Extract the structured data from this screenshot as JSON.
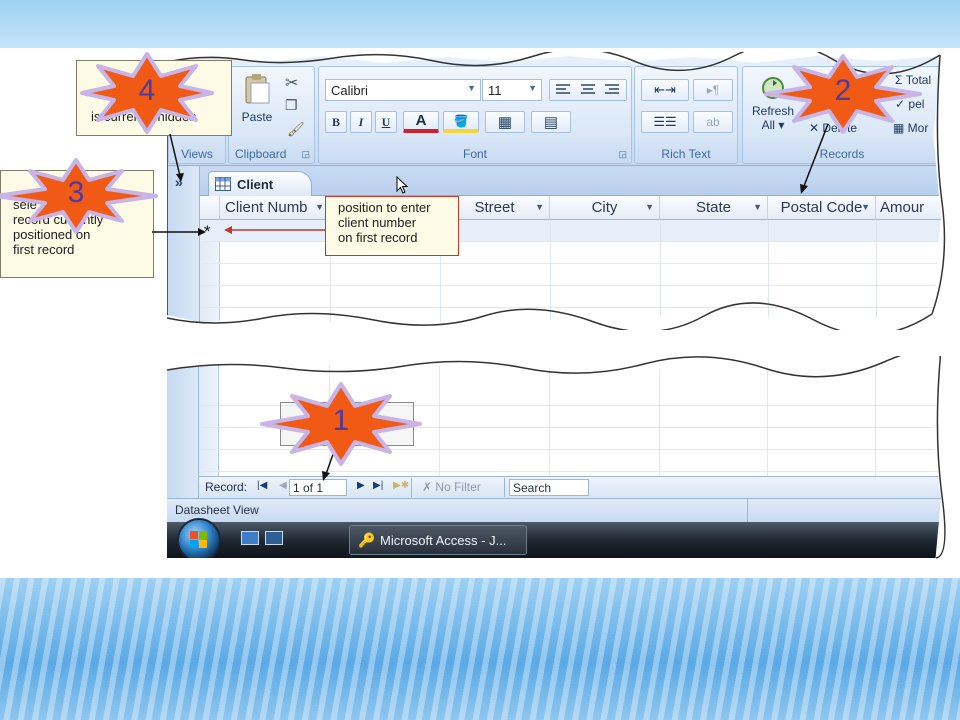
{
  "ribbon": {
    "views_label": "Views",
    "clipboard_label": "Clipboard",
    "paste_label": "Paste",
    "font_label": "Font",
    "font_name": "Calibri",
    "font_size": "11",
    "bold": "B",
    "italic": "I",
    "underline": "U",
    "font_color_letter": "A",
    "rich_text_label": "Rich Text",
    "records_label": "Records",
    "refresh_label": "Refresh",
    "refresh_all_label": "All",
    "delete_label": "Delete",
    "totals_label": "Total",
    "spelling_label": "pel",
    "more_label": "Mor"
  },
  "table_tab": {
    "label": "Client"
  },
  "columns": [
    "Client Numb",
    "Street",
    "City",
    "State",
    "Postal Code",
    "Amour"
  ],
  "new_record_marker": "*",
  "record_nav": {
    "label": "Record:",
    "current": "1 of 1",
    "filter": "No Filter",
    "search_placeholder": "Search"
  },
  "status_bar": {
    "text": "Datasheet View"
  },
  "taskbar": {
    "app_button": "Microsoft Access - J..."
  },
  "callouts": {
    "position_text_1": "position to enter",
    "position_text_2": "client number",
    "position_text_3": "on first record",
    "c3_line1": "sele",
    "c3_line2": "record currently",
    "c3_line3": "positioned on",
    "c3_line4": "first record",
    "c4_line2": "is currently hidden"
  },
  "stars": {
    "s1": "1",
    "s2": "2",
    "s3": "3",
    "s4": "4"
  },
  "colors": {
    "star_fill": "#f05a14",
    "star_glow": "#c8b4e6",
    "star_number": "#4b3aa0",
    "arrow_red": "#c0392b"
  }
}
